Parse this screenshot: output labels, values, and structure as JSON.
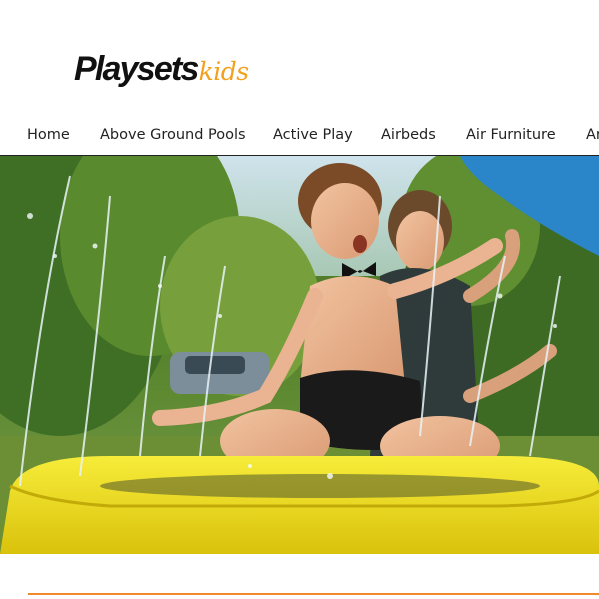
{
  "brand": {
    "name_main": "Playsets",
    "name_accent": "kids",
    "accent_color": "#f3a11c"
  },
  "nav": {
    "items": [
      {
        "label": "Home"
      },
      {
        "label": "Above Ground Pools"
      },
      {
        "label": "Active Play"
      },
      {
        "label": "Airbeds"
      },
      {
        "label": "Air Furniture"
      },
      {
        "label": "Ar"
      }
    ]
  },
  "hero": {
    "subject": "child and adult playing in yellow inflatable splash pool with water sprinklers"
  },
  "colors": {
    "rule": "#f08a2c",
    "pool": "#f2e21a"
  }
}
